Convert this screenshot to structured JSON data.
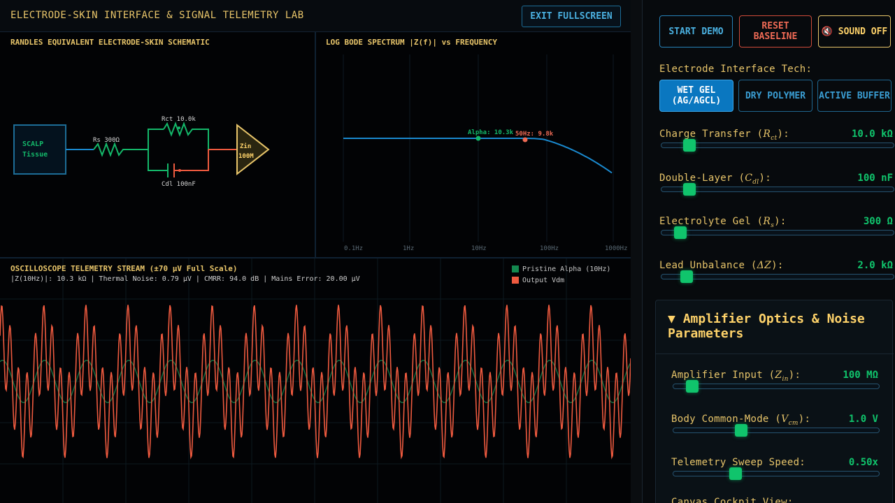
{
  "app_title": "ELECTRODE-SKIN INTERFACE & SIGNAL TELEMETRY LAB",
  "exit_label": "EXIT FULLSCREEN",
  "schematic": {
    "title": "RANDLES EQUIVALENT ELECTRODE-SKIN SCHEMATIC",
    "scalp_line1": "SCALP",
    "scalp_line2": "Tissue",
    "rs_label": "Rs 300Ω",
    "rct_label": "Rct 10.0k",
    "cdl_label": "Cdl 100nF",
    "zin_line1": "Zin",
    "zin_line2": "100M"
  },
  "bode": {
    "title": "LOG BODE SPECTRUM |Z(f)| vs FREQUENCY",
    "ticks": [
      "0.1Hz",
      "1Hz",
      "10Hz",
      "100Hz",
      "1000Hz"
    ],
    "alpha_marker": "Alpha: 10.3k",
    "mains_marker": "50Hz: 9.8k",
    "colors": {
      "curve": "#1a8ad0",
      "alpha": "#14b86a",
      "mains": "#ee6a55"
    }
  },
  "scope": {
    "title": "OSCILLOSCOPE TELEMETRY STREAM (±70 µV Full Scale)",
    "subtitle": "|Z(10Hz)|: 10.3 kΩ | Thermal Noise: 0.79 µV | CMRR: 94.0 dB | Mains Error: 20.00 µV",
    "legend": [
      {
        "label": "Pristine Alpha (10Hz)",
        "color": "#14884f"
      },
      {
        "label": "Output Vdm",
        "color": "#ee5a3f"
      }
    ]
  },
  "controls": {
    "start_label": "START DEMO",
    "reset_label": "RESET BASELINE",
    "sound_icon": "🔇",
    "sound_label": "SOUND OFF",
    "tech_label": "Electrode Interface Tech:",
    "tech_options": [
      "WET GEL (AG/AGCL)",
      "DRY POLYMER",
      "ACTIVE BUFFER"
    ],
    "sliders": [
      {
        "label": "Charge Transfer",
        "sym": "R",
        "sub": "ct",
        "value": "10.0 kΩ",
        "frac": 0.1
      },
      {
        "label": "Double-Layer",
        "sym": "C",
        "sub": "dl",
        "value": "100 nF",
        "frac": 0.1
      },
      {
        "label": "Electrolyte Gel",
        "sym": "R",
        "sub": "s",
        "value": "300 Ω",
        "frac": 0.06
      },
      {
        "label": "Lead Unbalance",
        "sym": "ΔZ",
        "sub": "",
        "value": "2.0 kΩ",
        "frac": 0.09
      }
    ],
    "optics_title": "Amplifier Optics & Noise Parameters",
    "optics_sliders": [
      {
        "label": "Amplifier Input",
        "sym": "Z",
        "sub": "in",
        "value": "100 MΩ",
        "frac": 0.07
      },
      {
        "label": "Body Common-Mode",
        "sym": "V",
        "sub": "cm",
        "value": "1.0 V",
        "frac": 0.32
      },
      {
        "label": "Telemetry Sweep Speed:",
        "sym": "",
        "sub": "",
        "value": "0.50x",
        "frac": 0.29
      }
    ],
    "canvas_label": "Canvas Cockpit View:"
  }
}
